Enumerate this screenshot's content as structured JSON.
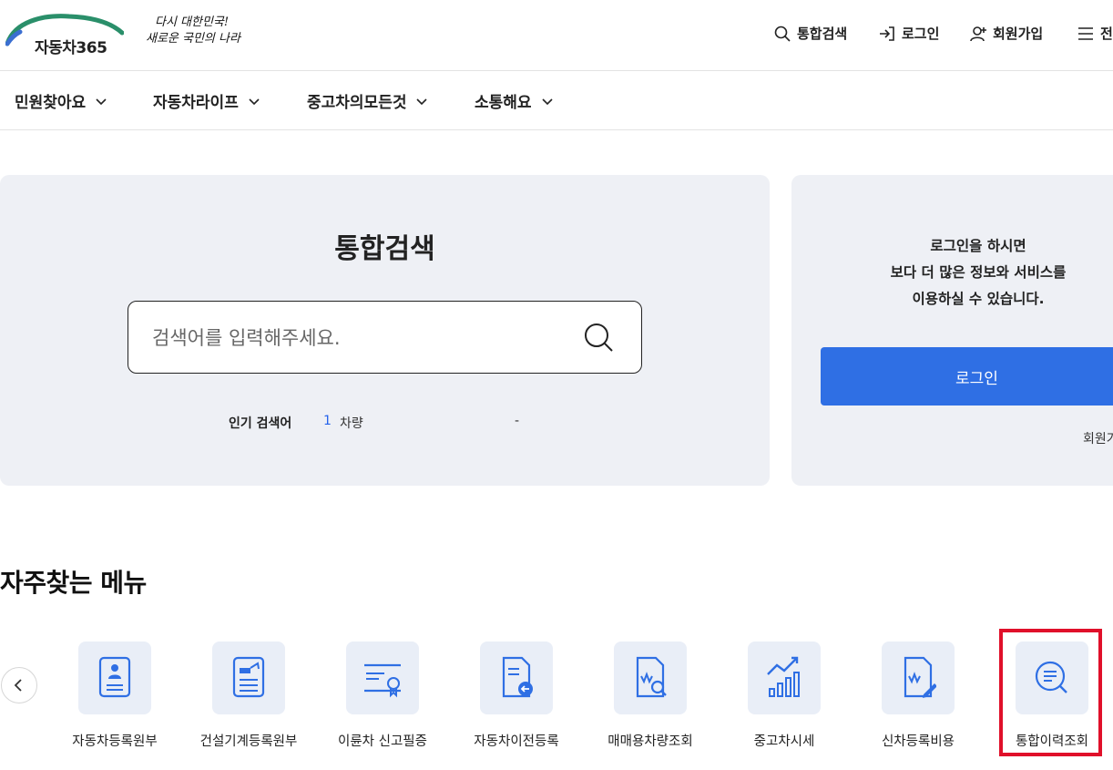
{
  "header": {
    "logo_text": "자동차365",
    "slogan_line1": "다시 대한민국!",
    "slogan_line2": "새로운 국민의 나라",
    "util": {
      "search": "통합검색",
      "login": "로그인",
      "signup": "회원가입",
      "menu": "전"
    }
  },
  "gnb": {
    "items": [
      {
        "label": "민원찾아요"
      },
      {
        "label": "자동차라이프"
      },
      {
        "label": "중고차의모든것"
      },
      {
        "label": "소통해요"
      }
    ]
  },
  "search": {
    "title": "통합검색",
    "placeholder": "검색어를 입력해주세요.",
    "popular_label": "인기 검색어",
    "popular_rank": "1",
    "popular_word": "차량",
    "popular_dash": "-"
  },
  "login_panel": {
    "message_line1": "로그인을 하시면",
    "message_line2": "보다 더 많은 정보와 서비스를",
    "message_line3": "이용하실 수 있습니다.",
    "button": "로그인",
    "join": "회원가입"
  },
  "favorites": {
    "title": "자주찾는 메뉴",
    "items": [
      {
        "label": "자동차등록원부",
        "icon": "registration-doc-icon"
      },
      {
        "label": "건설기계등록원부",
        "icon": "construction-doc-icon"
      },
      {
        "label": "이륜차 신고필증",
        "icon": "certificate-icon"
      },
      {
        "label": "자동차이전등록",
        "icon": "transfer-doc-icon"
      },
      {
        "label": "매매용차량조회",
        "icon": "price-search-doc-icon"
      },
      {
        "label": "중고차시세",
        "icon": "price-chart-icon"
      },
      {
        "label": "신차등록비용",
        "icon": "cost-doc-icon"
      },
      {
        "label": "통합이력조회",
        "icon": "history-search-icon"
      }
    ]
  },
  "colors": {
    "accent": "#2f6fe4",
    "panel_bg": "#eef0f5",
    "icon_bg": "#e9eef7",
    "highlight": "#e0102a"
  }
}
